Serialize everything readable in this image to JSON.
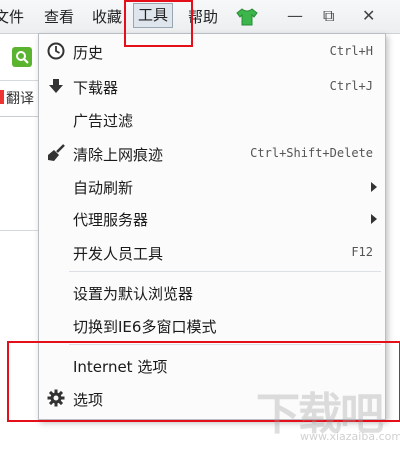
{
  "menubar": {
    "items": [
      "文件",
      "查看",
      "收藏",
      "工具",
      "帮助"
    ],
    "minimize": "—",
    "restore": "⧉",
    "close": "✕"
  },
  "left": {
    "translate_label": "翻译"
  },
  "menu": {
    "items": [
      {
        "label": "历史",
        "shortcut": "Ctrl+H",
        "icon": "clock-icon"
      },
      {
        "label": "下载器",
        "shortcut": "Ctrl+J",
        "icon": "download-arrow-icon"
      },
      {
        "label": "广告过滤",
        "shortcut": "",
        "icon": ""
      },
      {
        "label": "清除上网痕迹",
        "shortcut": "Ctrl+Shift+Delete",
        "icon": "broom-icon"
      },
      {
        "label": "自动刷新",
        "shortcut": "",
        "icon": "",
        "submenu": true
      },
      {
        "label": "代理服务器",
        "shortcut": "",
        "icon": "",
        "submenu": true
      },
      {
        "label": "开发人员工具",
        "shortcut": "F12",
        "icon": ""
      },
      {
        "label": "设置为默认浏览器",
        "shortcut": "",
        "icon": ""
      },
      {
        "label": "切换到IE6多窗口模式",
        "shortcut": "",
        "icon": ""
      },
      {
        "label": "Internet 选项",
        "shortcut": "",
        "icon": ""
      },
      {
        "label": "选项",
        "shortcut": "",
        "icon": "gear-icon"
      }
    ]
  },
  "watermark": {
    "logo": "下载吧",
    "url": "www.xiazaiba.com"
  },
  "colors": {
    "highlight_box": "#e3101b",
    "search_button": "#5bb42f",
    "tshirt": "#3cb54a"
  }
}
